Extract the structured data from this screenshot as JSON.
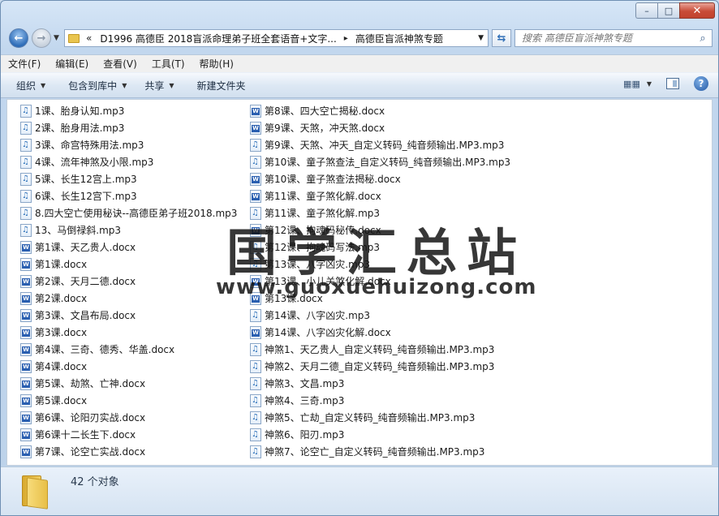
{
  "window": {
    "caption_buttons": {
      "minimize": "–",
      "maximize": "□",
      "close": "✕"
    }
  },
  "address": {
    "chevron": "«",
    "segments": [
      "D1996 高德臣 2018盲派命理弟子班全套语音+文字...",
      "高德臣盲派神煞专题"
    ],
    "separator": "▸",
    "dropdown": "▼"
  },
  "search": {
    "placeholder": "搜索 高德臣盲派神煞专题",
    "value": ""
  },
  "menu": [
    "文件(F)",
    "编辑(E)",
    "查看(V)",
    "工具(T)",
    "帮助(H)"
  ],
  "toolbar": {
    "organize": "组织",
    "include_library": "包含到库中",
    "share": "共享",
    "new_folder": "新建文件夹",
    "dropdown_glyph": "▼",
    "help": "?"
  },
  "files": {
    "column1": [
      {
        "name": "1课、胎身认知.mp3",
        "type": "mp3"
      },
      {
        "name": "2课、胎身用法.mp3",
        "type": "mp3"
      },
      {
        "name": "3课、命宫特殊用法.mp3",
        "type": "mp3"
      },
      {
        "name": "4课、流年神煞及小限.mp3",
        "type": "mp3"
      },
      {
        "name": "5课、长生12宫上.mp3",
        "type": "mp3"
      },
      {
        "name": "6课、长生12宫下.mp3",
        "type": "mp3"
      },
      {
        "name": "8.四大空亡使用秘诀--高德臣弟子班2018.mp3",
        "type": "mp3"
      },
      {
        "name": "13、马倒禄斜.mp3",
        "type": "mp3"
      },
      {
        "name": "第1课、天乙贵人.docx",
        "type": "doc"
      },
      {
        "name": "第1课.docx",
        "type": "doc"
      },
      {
        "name": "第2课、天月二德.docx",
        "type": "doc"
      },
      {
        "name": "第2课.docx",
        "type": "doc"
      },
      {
        "name": "第3课、文昌布局.docx",
        "type": "doc"
      },
      {
        "name": "第3课.docx",
        "type": "doc"
      },
      {
        "name": "第4课、三奇、德秀、华盖.docx",
        "type": "doc"
      },
      {
        "name": "第4课.docx",
        "type": "doc"
      },
      {
        "name": "第5课、劫煞、亡神.docx",
        "type": "doc"
      },
      {
        "name": "第5课.docx",
        "type": "doc"
      },
      {
        "name": "第6课、论阳刃实战.docx",
        "type": "doc"
      },
      {
        "name": "第6课十二长生下.docx",
        "type": "doc"
      },
      {
        "name": "第7课、论空亡实战.docx",
        "type": "doc"
      }
    ],
    "column2": [
      {
        "name": "第8课、四大空亡揭秘.docx",
        "type": "doc"
      },
      {
        "name": "第9课、天煞，冲天煞.docx",
        "type": "doc"
      },
      {
        "name": "第9课、天煞、冲天_自定义转码_纯音频输出.MP3.mp3",
        "type": "mp3"
      },
      {
        "name": "第10课、童子煞查法_自定义转码_纯音频输出.MP3.mp3",
        "type": "mp3"
      },
      {
        "name": "第10课、童子煞查法揭秘.docx",
        "type": "doc"
      },
      {
        "name": "第11课、童子煞化解.docx",
        "type": "doc"
      },
      {
        "name": "第11课、童子煞化解.mp3",
        "type": "mp3"
      },
      {
        "name": "第12课、拘魂码秘传.docx",
        "type": "doc"
      },
      {
        "name": "第12课、拘魂码写法.mp3",
        "type": "mp3"
      },
      {
        "name": "第13课、八字凶灾.mp3",
        "type": "mp3"
      },
      {
        "name": "第13课、小儿关煞化解.docx",
        "type": "doc"
      },
      {
        "name": "第13课.docx",
        "type": "doc"
      },
      {
        "name": "第14课、八字凶灾.mp3",
        "type": "mp3"
      },
      {
        "name": "第14课、八字凶灾化解.docx",
        "type": "doc"
      },
      {
        "name": "神煞1、天乙贵人_自定义转码_纯音频输出.MP3.mp3",
        "type": "mp3"
      },
      {
        "name": "神煞2、天月二德_自定义转码_纯音频输出.MP3.mp3",
        "type": "mp3"
      },
      {
        "name": "神煞3、文昌.mp3",
        "type": "mp3"
      },
      {
        "name": "神煞4、三奇.mp3",
        "type": "mp3"
      },
      {
        "name": "神煞5、亡劫_自定义转码_纯音频输出.MP3.mp3",
        "type": "mp3"
      },
      {
        "name": "神煞6、阳刃.mp3",
        "type": "mp3"
      },
      {
        "name": "神煞7、论空亡_自定义转码_纯音频输出.MP3.mp3",
        "type": "mp3"
      }
    ]
  },
  "watermark": {
    "title": "国学汇总站",
    "url": "www.guoxuehuizong.com"
  },
  "status": {
    "item_count": "42 个对象"
  },
  "icons": {
    "back": "←",
    "forward": "→",
    "refresh": "⇆",
    "search": "⌕"
  }
}
